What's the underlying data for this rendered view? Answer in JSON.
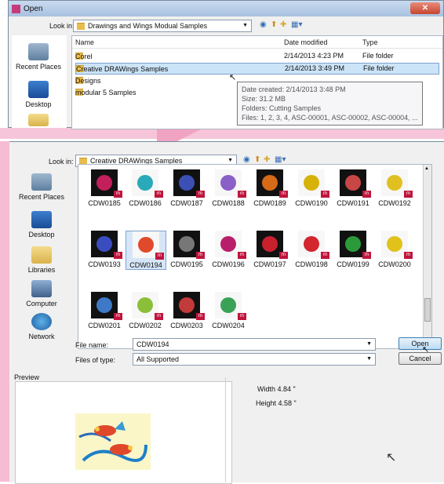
{
  "dialog1": {
    "title": "Open",
    "look_in_label": "Look in:",
    "look_in_value": "Drawings and Wings Modual Samples",
    "nav": [
      "Recent Places",
      "Desktop"
    ],
    "columns": {
      "name": "Name",
      "date": "Date modified",
      "type": "Type"
    },
    "rows": [
      {
        "name": "Corel",
        "date": "2/14/2013 4:23 PM",
        "type": "File folder"
      },
      {
        "name": "Creative DRAWings Samples",
        "date": "2/14/2013 3:49 PM",
        "type": "File folder"
      },
      {
        "name": "Designs",
        "date": "",
        "type": ""
      },
      {
        "name": "modular 5 Samples",
        "date": "",
        "type": ""
      }
    ],
    "tooltip": [
      "Date created: 2/14/2013 3:48 PM",
      "Size: 31.2 MB",
      "Folders: Cutting Samples",
      "Files: 1, 2, 3, 4, ASC-00001, ASC-00002, ASC-00004, ..."
    ]
  },
  "dialog2": {
    "look_in_label": "Look in:",
    "look_in_value": "Creative DRAWings Samples",
    "nav": [
      "Recent Places",
      "Desktop",
      "Libraries",
      "Computer",
      "Network"
    ],
    "thumbs": [
      {
        "label": "CDW0185",
        "color": "#c21f5b"
      },
      {
        "label": "CDW0186",
        "color": "#2aa9b8"
      },
      {
        "label": "CDW0187",
        "color": "#3b4fb5"
      },
      {
        "label": "CDW0188",
        "color": "#8a5fc7"
      },
      {
        "label": "CDW0189",
        "color": "#d66a17"
      },
      {
        "label": "CDW0190",
        "color": "#d7b20a"
      },
      {
        "label": "CDW0191",
        "color": "#c84646"
      },
      {
        "label": "CDW0192",
        "color": "#e0c020"
      },
      {
        "label": "CDW0193",
        "color": "#3a4dbf"
      },
      {
        "label": "CDW0194",
        "color": "#e04a2a"
      },
      {
        "label": "CDW0195",
        "color": "#777777"
      },
      {
        "label": "CDW0196",
        "color": "#b81f6a"
      },
      {
        "label": "CDW0197",
        "color": "#c9202e"
      },
      {
        "label": "CDW0198",
        "color": "#d3262e"
      },
      {
        "label": "CDW0199",
        "color": "#2a9a3a"
      },
      {
        "label": "CDW0200",
        "color": "#e0c21a"
      },
      {
        "label": "CDW0201",
        "color": "#3d79c7"
      },
      {
        "label": "CDW0202",
        "color": "#8bbf3a"
      },
      {
        "label": "CDW0203",
        "color": "#c23a3a"
      },
      {
        "label": "CDW0204",
        "color": "#3aa257"
      }
    ],
    "file_name_label": "File name:",
    "file_name_value": "CDW0194",
    "files_of_type_label": "Files of type:",
    "files_of_type_value": "All Supported",
    "open_label": "Open",
    "cancel_label": "Cancel",
    "preview_label": "Preview",
    "width_text": "Width 4.84 \"",
    "height_text": "Height 4.58 \""
  },
  "colors": {
    "accent": "#3399ff",
    "selection": "#cce4f7",
    "pink": "#f7c5da"
  }
}
